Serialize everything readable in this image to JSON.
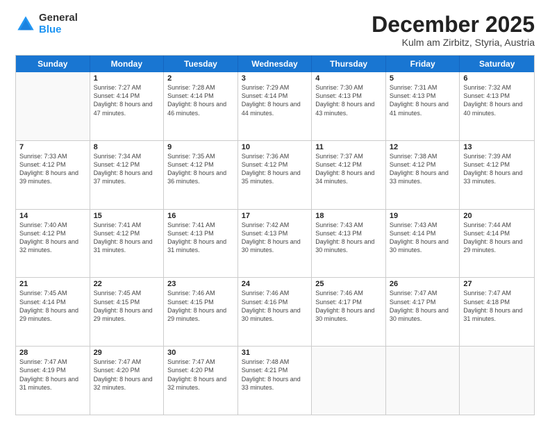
{
  "logo": {
    "general": "General",
    "blue": "Blue"
  },
  "title": {
    "month": "December 2025",
    "location": "Kulm am Zirbitz, Styria, Austria"
  },
  "weekdays": [
    "Sunday",
    "Monday",
    "Tuesday",
    "Wednesday",
    "Thursday",
    "Friday",
    "Saturday"
  ],
  "weeks": [
    [
      {
        "day": "",
        "empty": true
      },
      {
        "day": "1",
        "sunrise": "Sunrise: 7:27 AM",
        "sunset": "Sunset: 4:14 PM",
        "daylight": "Daylight: 8 hours and 47 minutes."
      },
      {
        "day": "2",
        "sunrise": "Sunrise: 7:28 AM",
        "sunset": "Sunset: 4:14 PM",
        "daylight": "Daylight: 8 hours and 46 minutes."
      },
      {
        "day": "3",
        "sunrise": "Sunrise: 7:29 AM",
        "sunset": "Sunset: 4:14 PM",
        "daylight": "Daylight: 8 hours and 44 minutes."
      },
      {
        "day": "4",
        "sunrise": "Sunrise: 7:30 AM",
        "sunset": "Sunset: 4:13 PM",
        "daylight": "Daylight: 8 hours and 43 minutes."
      },
      {
        "day": "5",
        "sunrise": "Sunrise: 7:31 AM",
        "sunset": "Sunset: 4:13 PM",
        "daylight": "Daylight: 8 hours and 41 minutes."
      },
      {
        "day": "6",
        "sunrise": "Sunrise: 7:32 AM",
        "sunset": "Sunset: 4:13 PM",
        "daylight": "Daylight: 8 hours and 40 minutes."
      }
    ],
    [
      {
        "day": "7",
        "sunrise": "Sunrise: 7:33 AM",
        "sunset": "Sunset: 4:12 PM",
        "daylight": "Daylight: 8 hours and 39 minutes."
      },
      {
        "day": "8",
        "sunrise": "Sunrise: 7:34 AM",
        "sunset": "Sunset: 4:12 PM",
        "daylight": "Daylight: 8 hours and 37 minutes."
      },
      {
        "day": "9",
        "sunrise": "Sunrise: 7:35 AM",
        "sunset": "Sunset: 4:12 PM",
        "daylight": "Daylight: 8 hours and 36 minutes."
      },
      {
        "day": "10",
        "sunrise": "Sunrise: 7:36 AM",
        "sunset": "Sunset: 4:12 PM",
        "daylight": "Daylight: 8 hours and 35 minutes."
      },
      {
        "day": "11",
        "sunrise": "Sunrise: 7:37 AM",
        "sunset": "Sunset: 4:12 PM",
        "daylight": "Daylight: 8 hours and 34 minutes."
      },
      {
        "day": "12",
        "sunrise": "Sunrise: 7:38 AM",
        "sunset": "Sunset: 4:12 PM",
        "daylight": "Daylight: 8 hours and 33 minutes."
      },
      {
        "day": "13",
        "sunrise": "Sunrise: 7:39 AM",
        "sunset": "Sunset: 4:12 PM",
        "daylight": "Daylight: 8 hours and 33 minutes."
      }
    ],
    [
      {
        "day": "14",
        "sunrise": "Sunrise: 7:40 AM",
        "sunset": "Sunset: 4:12 PM",
        "daylight": "Daylight: 8 hours and 32 minutes."
      },
      {
        "day": "15",
        "sunrise": "Sunrise: 7:41 AM",
        "sunset": "Sunset: 4:12 PM",
        "daylight": "Daylight: 8 hours and 31 minutes."
      },
      {
        "day": "16",
        "sunrise": "Sunrise: 7:41 AM",
        "sunset": "Sunset: 4:13 PM",
        "daylight": "Daylight: 8 hours and 31 minutes."
      },
      {
        "day": "17",
        "sunrise": "Sunrise: 7:42 AM",
        "sunset": "Sunset: 4:13 PM",
        "daylight": "Daylight: 8 hours and 30 minutes."
      },
      {
        "day": "18",
        "sunrise": "Sunrise: 7:43 AM",
        "sunset": "Sunset: 4:13 PM",
        "daylight": "Daylight: 8 hours and 30 minutes."
      },
      {
        "day": "19",
        "sunrise": "Sunrise: 7:43 AM",
        "sunset": "Sunset: 4:14 PM",
        "daylight": "Daylight: 8 hours and 30 minutes."
      },
      {
        "day": "20",
        "sunrise": "Sunrise: 7:44 AM",
        "sunset": "Sunset: 4:14 PM",
        "daylight": "Daylight: 8 hours and 29 minutes."
      }
    ],
    [
      {
        "day": "21",
        "sunrise": "Sunrise: 7:45 AM",
        "sunset": "Sunset: 4:14 PM",
        "daylight": "Daylight: 8 hours and 29 minutes."
      },
      {
        "day": "22",
        "sunrise": "Sunrise: 7:45 AM",
        "sunset": "Sunset: 4:15 PM",
        "daylight": "Daylight: 8 hours and 29 minutes."
      },
      {
        "day": "23",
        "sunrise": "Sunrise: 7:46 AM",
        "sunset": "Sunset: 4:15 PM",
        "daylight": "Daylight: 8 hours and 29 minutes."
      },
      {
        "day": "24",
        "sunrise": "Sunrise: 7:46 AM",
        "sunset": "Sunset: 4:16 PM",
        "daylight": "Daylight: 8 hours and 30 minutes."
      },
      {
        "day": "25",
        "sunrise": "Sunrise: 7:46 AM",
        "sunset": "Sunset: 4:17 PM",
        "daylight": "Daylight: 8 hours and 30 minutes."
      },
      {
        "day": "26",
        "sunrise": "Sunrise: 7:47 AM",
        "sunset": "Sunset: 4:17 PM",
        "daylight": "Daylight: 8 hours and 30 minutes."
      },
      {
        "day": "27",
        "sunrise": "Sunrise: 7:47 AM",
        "sunset": "Sunset: 4:18 PM",
        "daylight": "Daylight: 8 hours and 31 minutes."
      }
    ],
    [
      {
        "day": "28",
        "sunrise": "Sunrise: 7:47 AM",
        "sunset": "Sunset: 4:19 PM",
        "daylight": "Daylight: 8 hours and 31 minutes."
      },
      {
        "day": "29",
        "sunrise": "Sunrise: 7:47 AM",
        "sunset": "Sunset: 4:20 PM",
        "daylight": "Daylight: 8 hours and 32 minutes."
      },
      {
        "day": "30",
        "sunrise": "Sunrise: 7:47 AM",
        "sunset": "Sunset: 4:20 PM",
        "daylight": "Daylight: 8 hours and 32 minutes."
      },
      {
        "day": "31",
        "sunrise": "Sunrise: 7:48 AM",
        "sunset": "Sunset: 4:21 PM",
        "daylight": "Daylight: 8 hours and 33 minutes."
      },
      {
        "day": "",
        "empty": true
      },
      {
        "day": "",
        "empty": true
      },
      {
        "day": "",
        "empty": true
      }
    ]
  ]
}
